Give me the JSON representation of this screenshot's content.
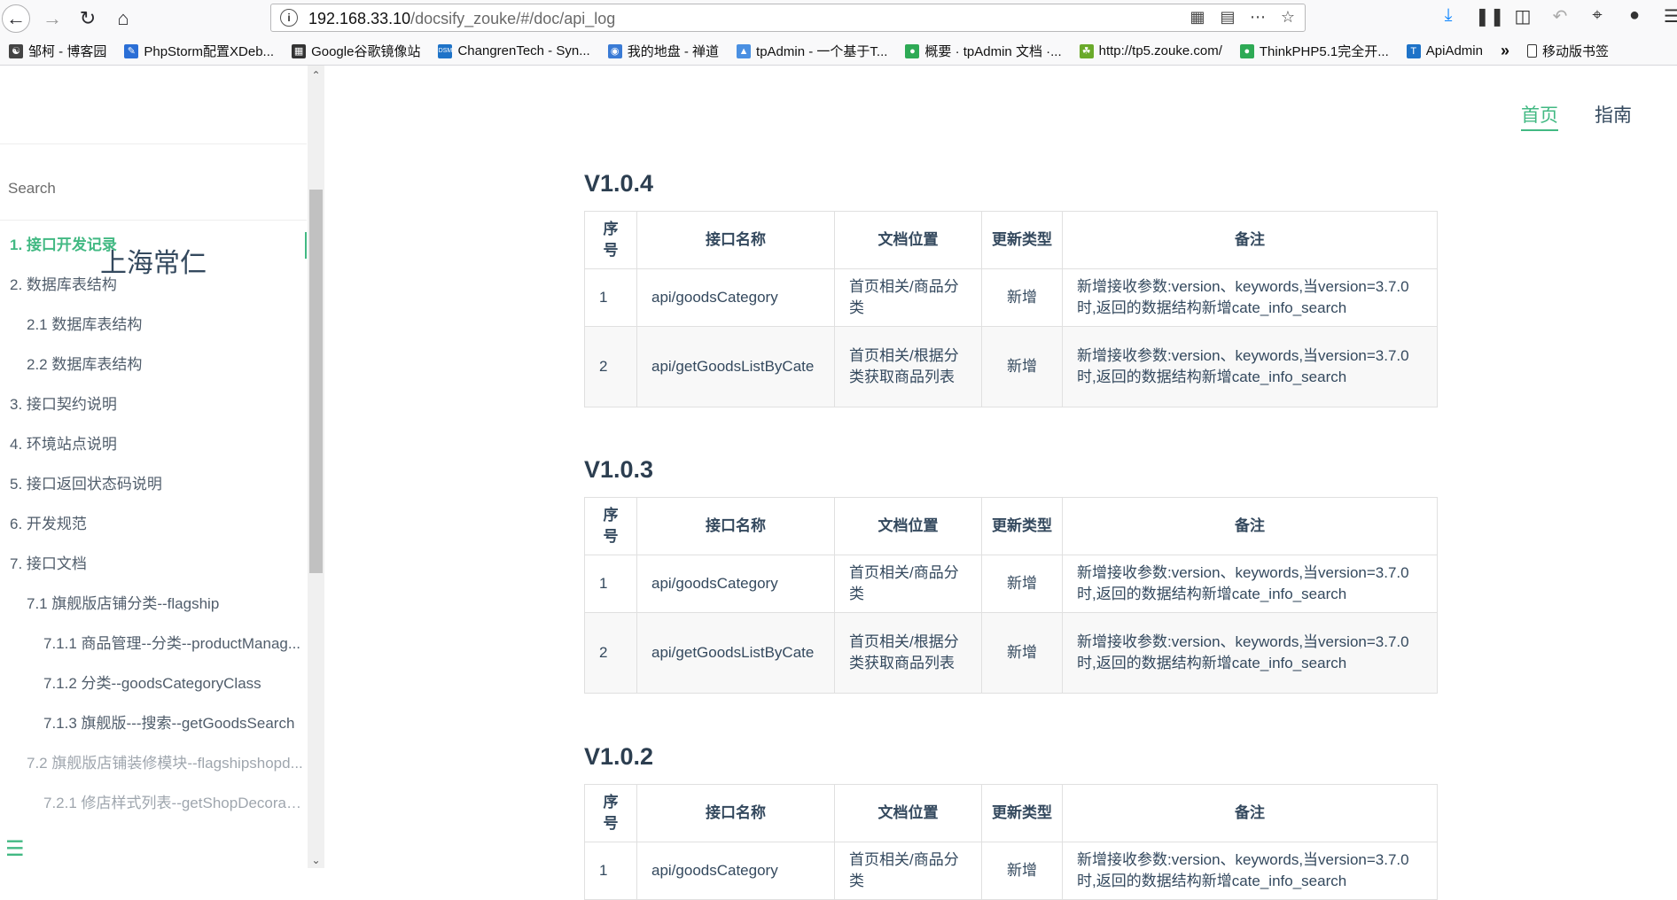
{
  "browser": {
    "url_host": "192.168.33.10",
    "url_path": "/docsify_zouke/#/doc/api_log",
    "bookmarks": [
      {
        "label": "邹柯 - 博客园",
        "icon": "cnblogs-icon",
        "color": "#444444"
      },
      {
        "label": "PhpStorm配置XDeb...",
        "icon": "pen-icon",
        "color": "#2b6fd6"
      },
      {
        "label": "Google谷歌镜像站",
        "icon": "grid-icon",
        "color": "#333333"
      },
      {
        "label": "ChangrenTech - Syn...",
        "icon": "dsm-icon",
        "color": "#1e73c8"
      },
      {
        "label": "我的地盘 - 禅道",
        "icon": "globe-icon",
        "color": "#3a7bd5"
      },
      {
        "label": "tpAdmin - 一个基于T...",
        "icon": "tp-icon",
        "color": "#4a90e2"
      },
      {
        "label": "概要 · tpAdmin 文档 ·...",
        "icon": "bug-icon",
        "color": "#2eaa55"
      },
      {
        "label": "http://tp5.zouke.com/",
        "icon": "leaf-icon",
        "color": "#6aaa2a"
      },
      {
        "label": "ThinkPHP5.1完全开...",
        "icon": "bug-icon",
        "color": "#2eaa55"
      },
      {
        "label": "ApiAdmin",
        "icon": "t-icon",
        "color": "#1e73c8"
      }
    ],
    "mobile_bookmarks": "移动版书签"
  },
  "sidebar": {
    "search_placeholder": "Search",
    "app_name": "上海常仁",
    "items": [
      {
        "label": "1. 接口开发记录",
        "level": 1,
        "active": true
      },
      {
        "label": "2. 数据库表结构",
        "level": 1
      },
      {
        "label": "2.1 数据库表结构",
        "level": 2
      },
      {
        "label": "2.2 数据库表结构",
        "level": 2
      },
      {
        "label": "3. 接口契约说明",
        "level": 1
      },
      {
        "label": "4. 环境站点说明",
        "level": 1
      },
      {
        "label": "5. 接口返回状态码说明",
        "level": 1
      },
      {
        "label": "6. 开发规范",
        "level": 1
      },
      {
        "label": "7. 接口文档",
        "level": 1
      },
      {
        "label": "7.1 旗舰版店铺分类--flagship",
        "level": 2
      },
      {
        "label": "7.1.1 商品管理--分类--productManag...",
        "level": 3
      },
      {
        "label": "7.1.2 分类--goodsCategoryClass",
        "level": 3
      },
      {
        "label": "7.1.3 旗舰版---搜索--getGoodsSearch",
        "level": 3
      },
      {
        "label": "7.2 旗舰版店铺装修模块--flagshipshopd...",
        "level": 2
      },
      {
        "label": "7.2.1 修店样式列表--getShopDecorate...",
        "level": 3
      }
    ]
  },
  "topnav": {
    "home": "首页",
    "guide": "指南"
  },
  "table_headers": [
    "序号",
    "接口名称",
    "文档位置",
    "更新类型",
    "备注"
  ],
  "versions": [
    {
      "title": "V1.0.4",
      "rows": [
        {
          "no": "1",
          "name": "api/goodsCategory",
          "location": "首页相关/商品分类",
          "type": "新增",
          "note": "新增接收参数:version、keywords,当version=3.7.0时,返回的数据结构新增cate_info_search"
        },
        {
          "no": "2",
          "name": "api/getGoodsListByCate",
          "location": "首页相关/根据分类获取商品列表",
          "type": "新增",
          "note": "新增接收参数:version、keywords,当version=3.7.0时,返回的数据结构新增cate_info_search"
        }
      ]
    },
    {
      "title": "V1.0.3",
      "rows": [
        {
          "no": "1",
          "name": "api/goodsCategory",
          "location": "首页相关/商品分类",
          "type": "新增",
          "note": "新增接收参数:version、keywords,当version=3.7.0时,返回的数据结构新增cate_info_search"
        },
        {
          "no": "2",
          "name": "api/getGoodsListByCate",
          "location": "首页相关/根据分类获取商品列表",
          "type": "新增",
          "note": "新增接收参数:version、keywords,当version=3.7.0时,返回的数据结构新增cate_info_search"
        }
      ]
    },
    {
      "title": "V1.0.2",
      "rows": [
        {
          "no": "1",
          "name": "api/goodsCategory",
          "location": "首页相关/商品分类",
          "type": "新增",
          "note": "新增接收参数:version、keywords,当version=3.7.0时,返回的数据结构新增cate_info_search"
        }
      ]
    }
  ],
  "colors": {
    "accent": "#42b983",
    "text": "#34495e"
  }
}
